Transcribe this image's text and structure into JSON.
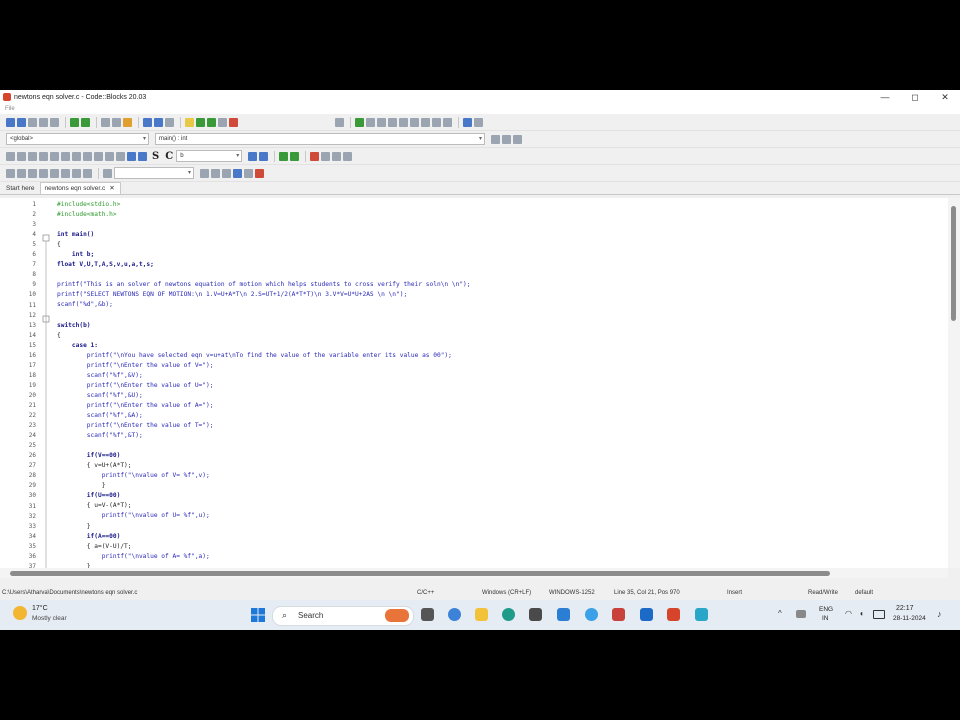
{
  "window": {
    "title": "newtons eqn solver.c - Code::Blocks 20.03",
    "menu_label": "File",
    "controls": {
      "minimize": "—",
      "maximize": "◻",
      "close": "✕"
    }
  },
  "toolbar": {
    "scope_combo": "<global>",
    "function_combo": "main() : int",
    "search_combo": "b",
    "bold_s": "S",
    "bold_c": "C"
  },
  "tabs": [
    {
      "label": "Start here",
      "active": false
    },
    {
      "label": "newtons eqn solver.c",
      "active": true,
      "close": "✕"
    }
  ],
  "editor": {
    "line_numbers": [
      "1",
      "2",
      "3",
      "4",
      "5",
      "6",
      "7",
      "8",
      "9",
      "10",
      "11",
      "12",
      "13",
      "14",
      "15",
      "16",
      "17",
      "18",
      "19",
      "20",
      "21",
      "22",
      "23",
      "24",
      "25",
      "26",
      "27",
      "28",
      "29",
      "30",
      "31",
      "32",
      "33",
      "34",
      "35",
      "36",
      "37"
    ],
    "lines": [
      {
        "t": "#include<stdio.h>",
        "c": "pp"
      },
      {
        "t": "#include<math.h>",
        "c": "pp"
      },
      {
        "t": "",
        "c": "pl"
      },
      {
        "t": "int main()",
        "c": "ty"
      },
      {
        "t": "{",
        "c": "pl"
      },
      {
        "t": "    int b;",
        "c": "ty"
      },
      {
        "t": "float V,U,T,A,S,v,u,a,t,s;",
        "c": "ty"
      },
      {
        "t": "",
        "c": "pl"
      },
      {
        "t": "printf(\"This is an solver of newtons equation of motion which helps students to cross verify their soln\\n \\n\");",
        "c": "str"
      },
      {
        "t": "printf(\"SELECT NEWTONS EQN OF MOTION:\\n 1.V=U+A*T\\n 2.S=UT+1/2(A*T*T)\\n 3.V*V=U*U+2AS \\n \\n\");",
        "c": "str"
      },
      {
        "t": "scanf(\"%d\",&b);",
        "c": "str"
      },
      {
        "t": "",
        "c": "pl"
      },
      {
        "t": "switch(b)",
        "c": "kw"
      },
      {
        "t": "{",
        "c": "pl"
      },
      {
        "t": "    case 1:",
        "c": "kw"
      },
      {
        "t": "        printf(\"\\nYou have selected eqn v=u+at\\nTo find the value of the variable enter its value as 00\");",
        "c": "str"
      },
      {
        "t": "        printf(\"\\nEnter the value of V=\");",
        "c": "str"
      },
      {
        "t": "        scanf(\"%f\",&V);",
        "c": "str"
      },
      {
        "t": "        printf(\"\\nEnter the value of U=\");",
        "c": "str"
      },
      {
        "t": "        scanf(\"%f\",&U);",
        "c": "str"
      },
      {
        "t": "        printf(\"\\nEnter the value of A=\");",
        "c": "str"
      },
      {
        "t": "        scanf(\"%f\",&A);",
        "c": "str"
      },
      {
        "t": "        printf(\"\\nEnter the value of T=\");",
        "c": "str"
      },
      {
        "t": "        scanf(\"%f\",&T);",
        "c": "str"
      },
      {
        "t": "",
        "c": "pl"
      },
      {
        "t": "        if(V==00)",
        "c": "kw"
      },
      {
        "t": "        { v=U+(A*T);",
        "c": "pl"
      },
      {
        "t": "            printf(\"\\nvalue of V= %f\",v);",
        "c": "str"
      },
      {
        "t": "            }",
        "c": "pl"
      },
      {
        "t": "        if(U==00)",
        "c": "kw"
      },
      {
        "t": "        { u=V-(A*T);",
        "c": "pl"
      },
      {
        "t": "            printf(\"\\nvalue of U= %f\",u);",
        "c": "str"
      },
      {
        "t": "        }",
        "c": "pl"
      },
      {
        "t": "        if(A==00)",
        "c": "kw"
      },
      {
        "t": "        { a=(V-U)/T;",
        "c": "pl"
      },
      {
        "t": "            printf(\"\\nvalue of A= %f\",a);",
        "c": "str"
      },
      {
        "t": "        }",
        "c": "pl"
      }
    ]
  },
  "statusbar": {
    "path": "C:\\Users\\Atharva\\Documents\\newtons eqn solver.c",
    "language": "C/C++",
    "line_endings": "Windows (CR+LF)",
    "encoding": "WINDOWS-1252",
    "position": "Line 35, Col 21, Pos 970",
    "mode": "Insert",
    "access": "Read/Write",
    "profile": "default"
  },
  "taskbar": {
    "weather_temp": "17°C",
    "weather_desc": "Mostly clear",
    "search_label": "Search",
    "lang_top": "ENG",
    "lang_bottom": "IN",
    "time": "22:17",
    "date": "28-11-2024",
    "tray_chevron": "^"
  }
}
